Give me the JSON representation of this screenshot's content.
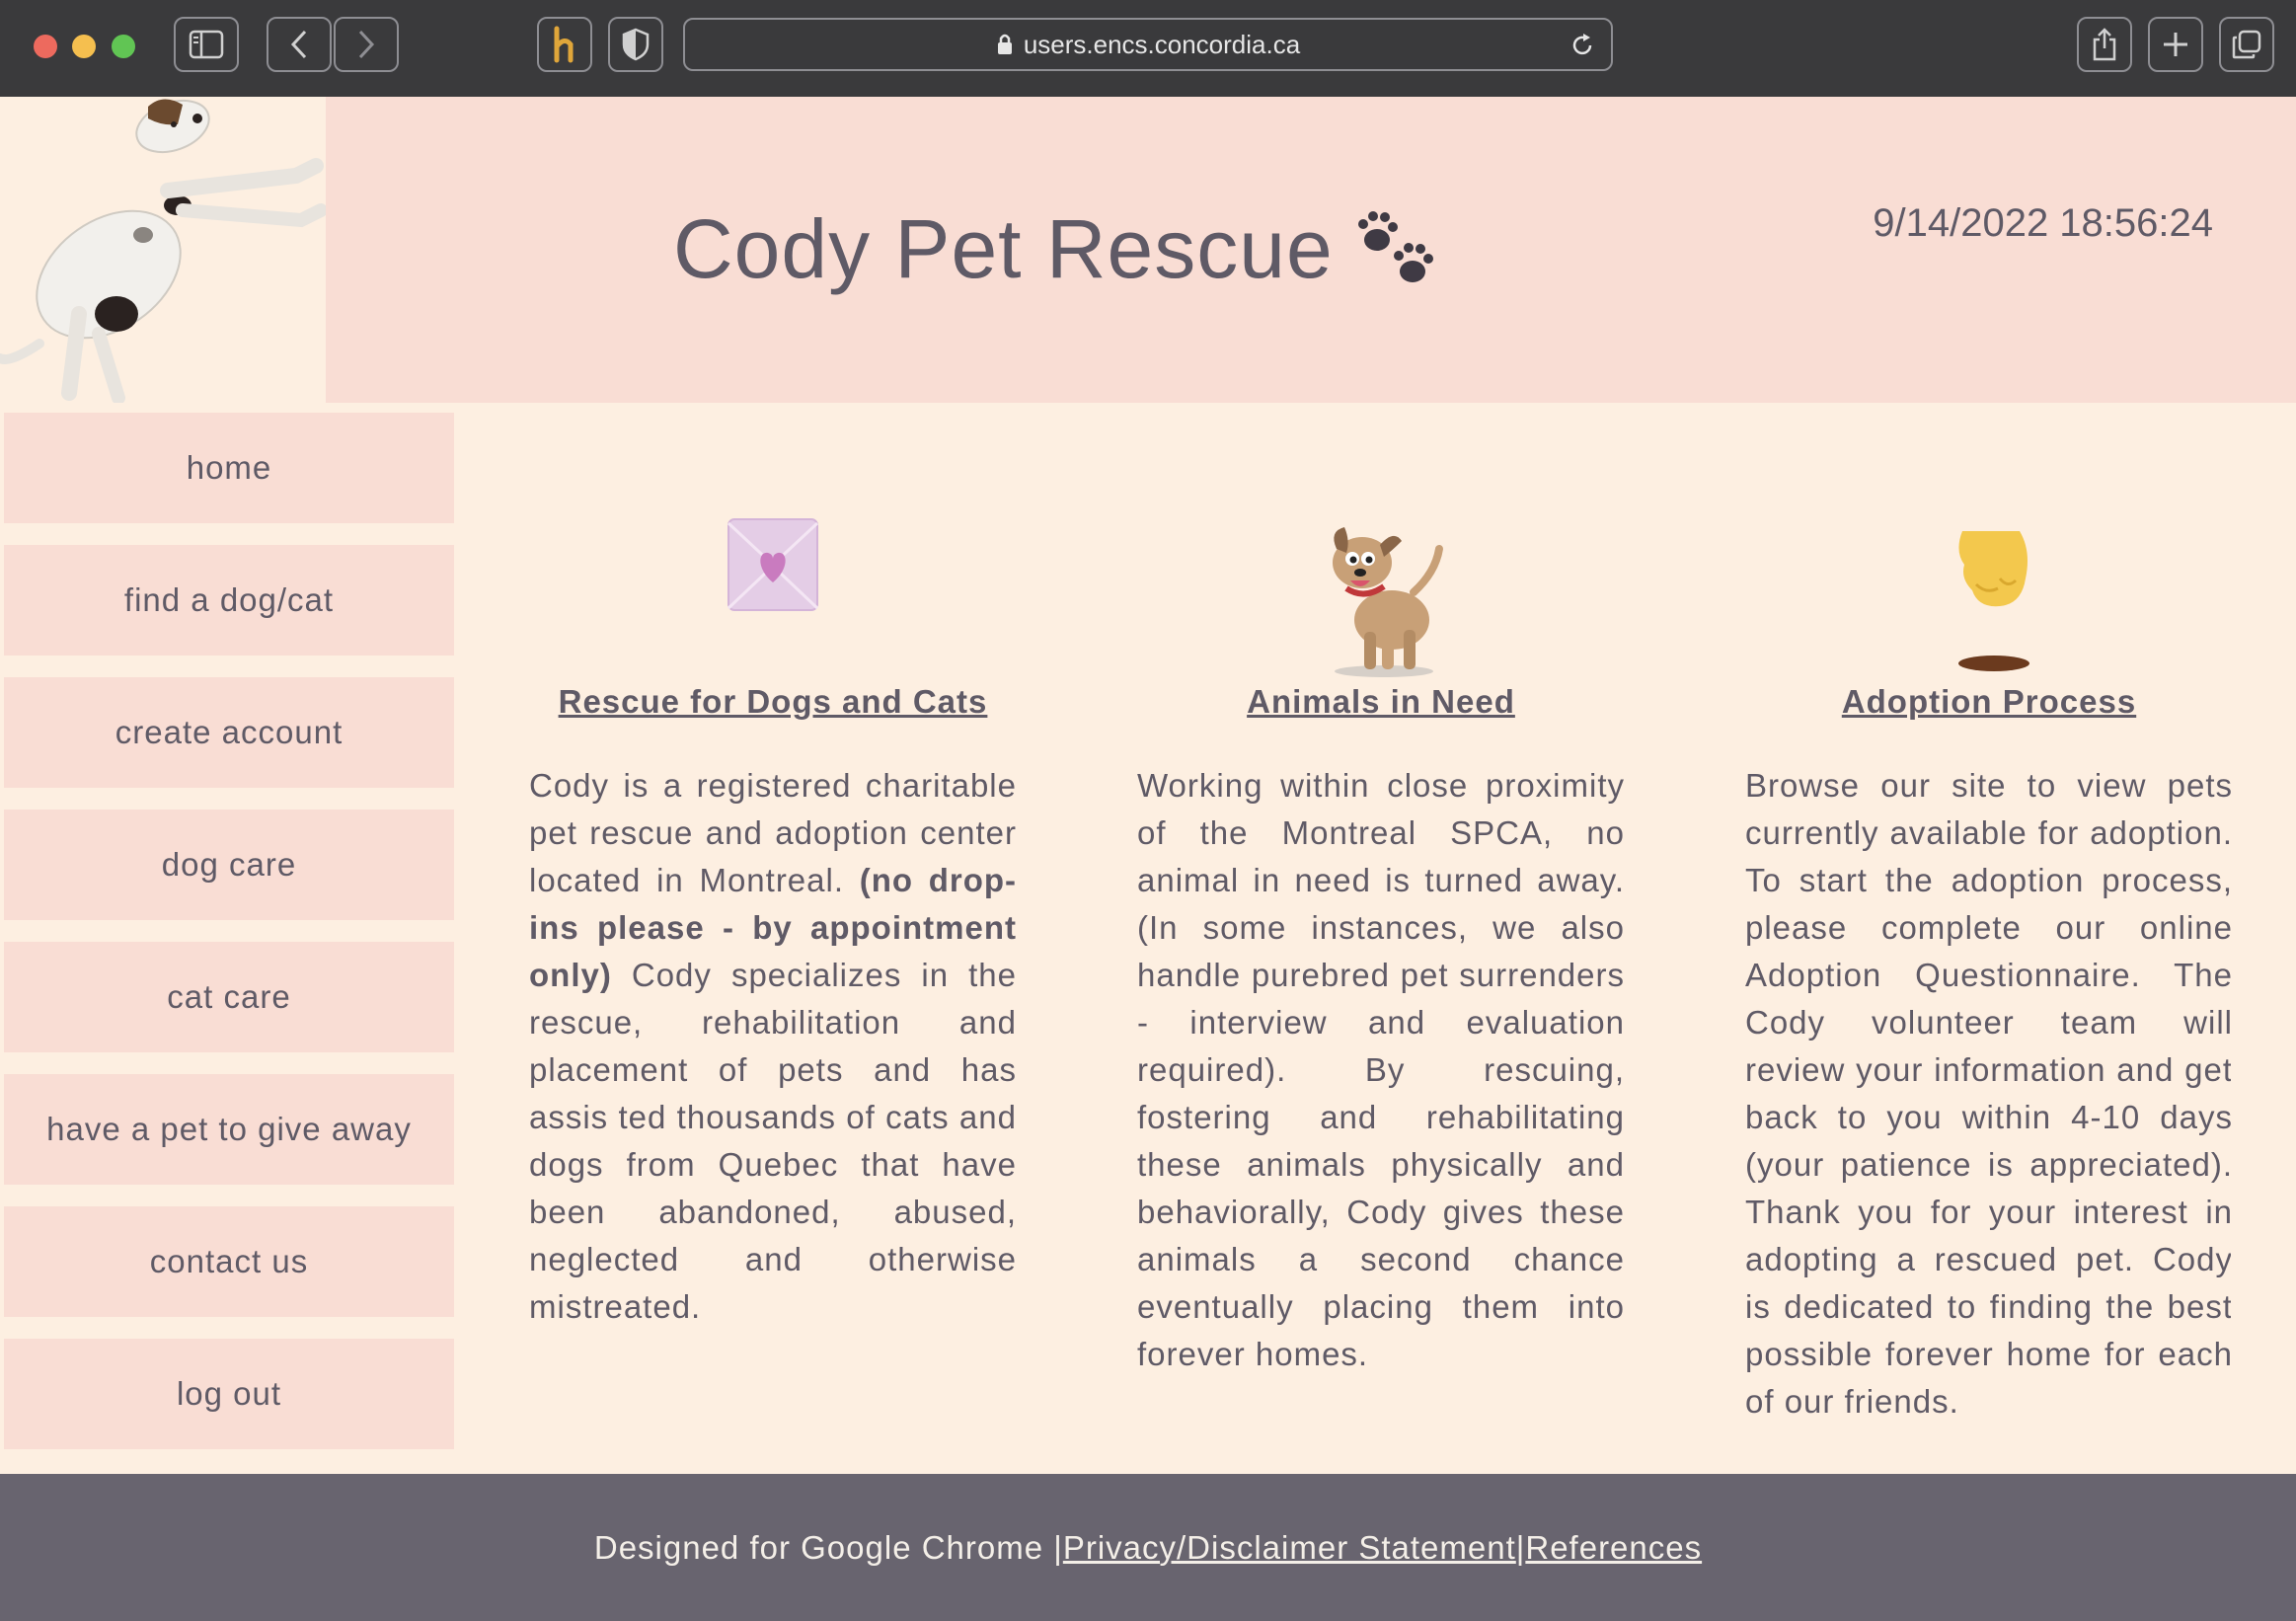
{
  "browser": {
    "url": "users.encs.concordia.ca"
  },
  "header": {
    "timestamp": "9/14/2022 18:56:24",
    "title": "Cody Pet Rescue"
  },
  "sidebar": {
    "items": [
      {
        "label": "home"
      },
      {
        "label": "find a dog/cat"
      },
      {
        "label": "create account"
      },
      {
        "label": "dog care"
      },
      {
        "label": "cat care"
      },
      {
        "label": "have a pet to give away"
      },
      {
        "label": "contact us"
      },
      {
        "label": "log out"
      }
    ]
  },
  "columns": [
    {
      "heading": "Rescue for Dogs and Cats",
      "icon": "heart-envelope-icon",
      "text_before": "Cody is a registered charitable pet rescue and adoption center located in Montreal. ",
      "text_bold": "(no drop-ins please - by appointment only)",
      "text_after": " Cody specializes in the rescue, rehabilitation and placement of pets and has assis ted thousands of cats and dogs from Quebec that have been abandoned, abused, neglected and otherwise mistreated."
    },
    {
      "heading": "Animals in Need",
      "icon": "cartoon-dog-icon",
      "text": "Working within close proximity of the Montreal SPCA, no animal in need is turned away. (In some instances, we also handle purebred pet surrenders - interview and evaluation required). By rescuing, fostering and rehabilitating these animals physically and behaviorally, Cody gives these animals a second chance eventually placing them into forever homes."
    },
    {
      "heading": "Adoption Process",
      "icon": "hand-drop-icon",
      "text": "Browse our site to view pets currently available for adoption. To start the adoption process, please complete our online Adoption Questionnaire. The Cody volunteer team will review your information and get back to you within 4-10 days (your patience is appreciated). Thank you for your interest in adopting a rescued pet. Cody is dedicated to finding the best possible forever home for each of our friends."
    }
  ],
  "footer": {
    "prefix": "Designed for Google Chrome |",
    "privacy_link": "Privacy/Disclaimer Statement",
    "separator": "|",
    "references_link": "References"
  },
  "colors": {
    "page_bg": "#fdefe1",
    "header_band": "#f9ddd4",
    "text": "#5f5a66",
    "footer_bg": "#68646f"
  }
}
